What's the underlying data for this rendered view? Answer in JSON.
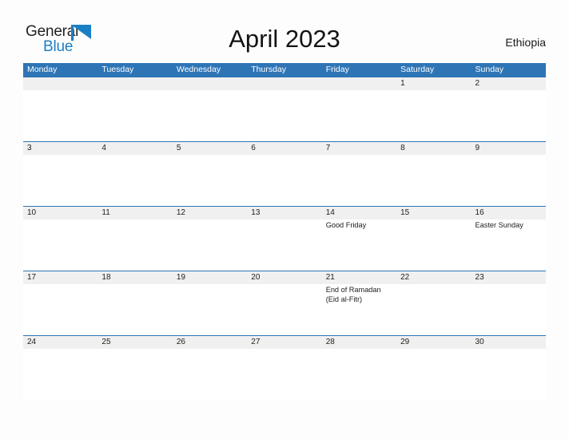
{
  "brand": {
    "name_part1": "General",
    "name_part2": "Blue",
    "flag_icon": "blue-triangle-flag-icon",
    "color_dark": "#231f20",
    "color_blue": "#1b7fc4"
  },
  "header": {
    "title": "April 2023",
    "region": "Ethiopia"
  },
  "calendar": {
    "accent_color": "#2e75b6",
    "number_band_color": "#f0f0f0",
    "weekdays": [
      "Monday",
      "Tuesday",
      "Wednesday",
      "Thursday",
      "Friday",
      "Saturday",
      "Sunday"
    ],
    "weeks": [
      [
        {
          "day": ""
        },
        {
          "day": ""
        },
        {
          "day": ""
        },
        {
          "day": ""
        },
        {
          "day": ""
        },
        {
          "day": "1",
          "events": []
        },
        {
          "day": "2",
          "events": []
        }
      ],
      [
        {
          "day": "3",
          "events": []
        },
        {
          "day": "4",
          "events": []
        },
        {
          "day": "5",
          "events": []
        },
        {
          "day": "6",
          "events": []
        },
        {
          "day": "7",
          "events": []
        },
        {
          "day": "8",
          "events": []
        },
        {
          "day": "9",
          "events": []
        }
      ],
      [
        {
          "day": "10",
          "events": []
        },
        {
          "day": "11",
          "events": []
        },
        {
          "day": "12",
          "events": []
        },
        {
          "day": "13",
          "events": []
        },
        {
          "day": "14",
          "events": [
            "Good Friday"
          ]
        },
        {
          "day": "15",
          "events": []
        },
        {
          "day": "16",
          "events": [
            "Easter Sunday"
          ]
        }
      ],
      [
        {
          "day": "17",
          "events": []
        },
        {
          "day": "18",
          "events": []
        },
        {
          "day": "19",
          "events": []
        },
        {
          "day": "20",
          "events": []
        },
        {
          "day": "21",
          "events": [
            "End of Ramadan",
            "(Eid al-Fitr)"
          ]
        },
        {
          "day": "22",
          "events": []
        },
        {
          "day": "23",
          "events": []
        }
      ],
      [
        {
          "day": "24",
          "events": []
        },
        {
          "day": "25",
          "events": []
        },
        {
          "day": "26",
          "events": []
        },
        {
          "day": "27",
          "events": []
        },
        {
          "day": "28",
          "events": []
        },
        {
          "day": "29",
          "events": []
        },
        {
          "day": "30",
          "events": []
        }
      ]
    ]
  }
}
